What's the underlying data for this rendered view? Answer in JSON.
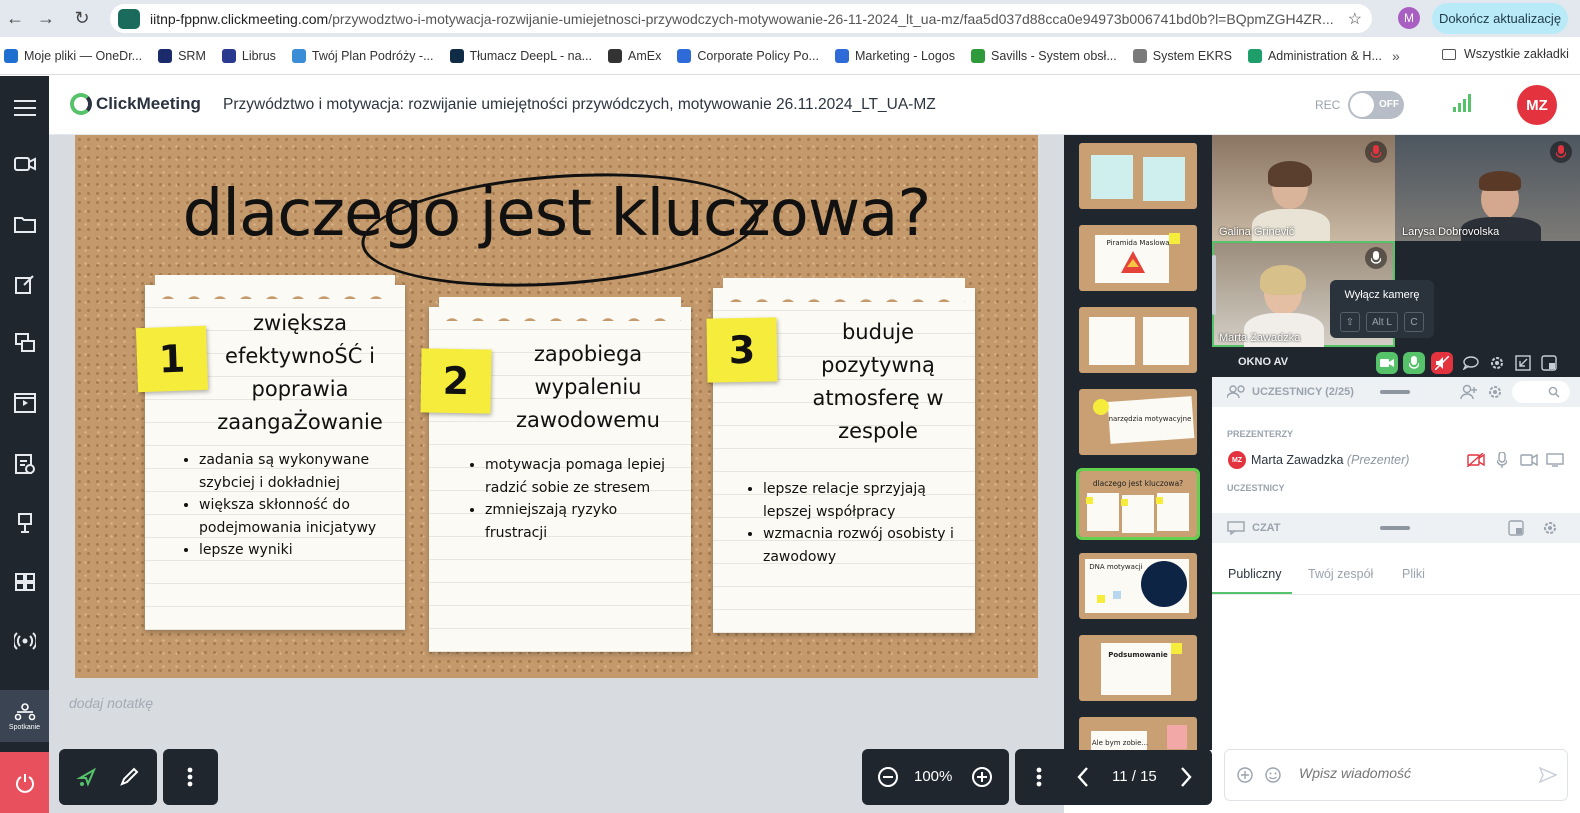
{
  "browser": {
    "url_host": "iitnp-fppnw.clickmeeting.com",
    "url_path": "/przywodztwo-i-motywacja-rozwijanie-umiejetnosci-przywodczych-motywowanie-26-11-2024_lt_ua-mz/faa5d037d88cca0e94973b006741bd0b?l=BQpmZGH4ZR...",
    "profile_initial": "M",
    "update_button": "Dokończ aktualizację",
    "bookmarks": [
      {
        "label": "Moje pliki — OneDr...",
        "color": "#1f6fd1"
      },
      {
        "label": "SRM",
        "color": "#1b2a6b"
      },
      {
        "label": "Librus",
        "color": "#2a3b8f"
      },
      {
        "label": "Twój Plan Podróży -...",
        "color": "#3b8ed6"
      },
      {
        "label": "Tłumacz DeepL - na...",
        "color": "#0f2b46"
      },
      {
        "label": "AmEx",
        "color": "#333333"
      },
      {
        "label": "Corporate Policy Po...",
        "color": "#2f6bd8"
      },
      {
        "label": "Marketing - Logos",
        "color": "#2f6bd8"
      },
      {
        "label": "Savills - System obsł...",
        "color": "#2e9a3a"
      },
      {
        "label": "System EKRS",
        "color": "#7a7a7a"
      },
      {
        "label": "Administration & H...",
        "color": "#1e9e6a"
      }
    ],
    "more": "»",
    "all_bookmarks": "Wszystkie zakładki"
  },
  "header": {
    "logo": "ClickMeeting",
    "title": "Przywództwo i motywacja: rozwijanie umiejętności przywódczych, motywowanie 26.11.2024_LT_UA-MZ",
    "rec_label": "REC",
    "rec_state": "OFF",
    "avatar_initials": "MZ"
  },
  "rail": {
    "meeting_label": "Spotkanie"
  },
  "slide": {
    "title": "dlaczego jest kluczowa?",
    "notes": [
      {
        "number": "1",
        "heading": [
          "zwiększa",
          "efektywnoŚĆ i",
          "poprawia",
          "zaangaŻowanie"
        ],
        "items": [
          "zadania są wykonywane szybciej i dokładniej",
          "większa skłonność do podejmowania inicjatywy",
          "lepsze wyniki"
        ]
      },
      {
        "number": "2",
        "heading": [
          "zapobiega",
          "wypaleniu",
          "zawodowemu"
        ],
        "items": [
          "motywacja pomaga lepiej radzić sobie ze stresem",
          "zmniejszają ryzyko frustracji"
        ]
      },
      {
        "number": "3",
        "heading": [
          "buduje",
          "pozytywną",
          "atmosferę w",
          "zespole"
        ],
        "items": [
          "lepsze relacje sprzyjają lepszej współpracy",
          "wzmacnia rozwój osobisty i zawodowy"
        ]
      }
    ]
  },
  "notes_placeholder": "dodaj notatkę",
  "zoom": "100%",
  "page_indicator": "11 / 15",
  "thumbnails": [
    {
      "caption": ""
    },
    {
      "caption": "Piramida Maslowa"
    },
    {
      "caption": ""
    },
    {
      "caption": "narzędzia motywacyjne"
    },
    {
      "caption": "dlaczego jest kluczowa?",
      "active": true
    },
    {
      "caption": "DNA motywacji"
    },
    {
      "caption": "Podsumowanie"
    },
    {
      "caption": "Ale bym zobie..."
    }
  ],
  "video": {
    "tiles": [
      {
        "name": "Galina Grinevič"
      },
      {
        "name": "Larysa Dobrovolska"
      },
      {
        "name": "Marta Zawadzka"
      }
    ],
    "tooltip": {
      "label": "Wyłącz kamerę",
      "keys": [
        "Alt L",
        "C"
      ]
    }
  },
  "av_window": {
    "label": "OKNO AV"
  },
  "participants": {
    "title": "UCZESTNICY (2/25)",
    "presenters_label": "PREZENTERZY",
    "presenter_initials": "MZ",
    "presenter_name": "Marta Zawadzka",
    "presenter_role": "(Prezenter)",
    "attendees_label": "UCZESTNICY"
  },
  "chat": {
    "title": "CZAT",
    "tabs": [
      "Publiczny",
      "Twój zespół",
      "Pliki"
    ],
    "placeholder": "Wpisz wiadomość"
  },
  "colors": {
    "accent_green": "#56c36b",
    "rail_dark": "#1f262e",
    "brand_red": "#e2333f",
    "sticky_yellow": "#f6ec3c"
  },
  "icons": [
    "back-icon",
    "forward-icon",
    "reload-icon",
    "star-icon",
    "hamburger-icon",
    "camera-icon",
    "folder-icon",
    "edit-icon",
    "screens-icon",
    "video-player-icon",
    "checklist-icon",
    "whiteboard-icon",
    "grid-icon",
    "broadcast-icon",
    "meeting-icon",
    "power-icon",
    "pointer-icon",
    "pencil-icon",
    "more-icon",
    "zoom-out-icon",
    "zoom-in-icon",
    "prev-icon",
    "next-icon",
    "mic-icon",
    "settings-icon",
    "emoji-icon",
    "send-icon"
  ]
}
